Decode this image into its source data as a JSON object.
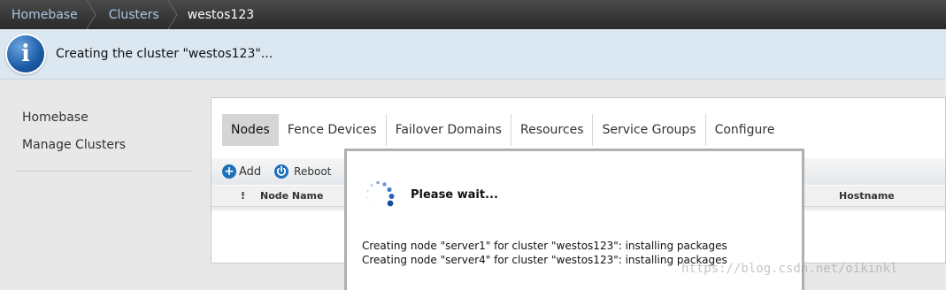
{
  "breadcrumb": {
    "items": [
      {
        "label": "Homebase"
      },
      {
        "label": "Clusters"
      }
    ],
    "current": "westos123"
  },
  "info_banner": {
    "icon": "info-icon",
    "glyph": "i",
    "message": "Creating the cluster \"westos123\"..."
  },
  "sidebar": {
    "items": [
      {
        "label": "Homebase"
      },
      {
        "label": "Manage Clusters"
      }
    ]
  },
  "tabs": [
    {
      "label": "Nodes",
      "active": true
    },
    {
      "label": "Fence Devices"
    },
    {
      "label": "Failover Domains"
    },
    {
      "label": "Resources"
    },
    {
      "label": "Service Groups"
    },
    {
      "label": "Configure"
    }
  ],
  "toolbar": {
    "add_glyph": "+",
    "add_label": "Add",
    "reboot_label": "Reboot"
  },
  "table": {
    "columns": {
      "status": "!",
      "node_name": "Node Name",
      "hostname": "Hostname"
    }
  },
  "modal": {
    "title": "Please wait...",
    "messages": [
      "Creating node \"server1\" for cluster \"westos123\": installing packages",
      "Creating node \"server4\" for cluster \"westos123\": installing packages"
    ]
  },
  "watermark": "https://blog.csdn.net/oikinkl",
  "colors": {
    "accent_blue": "#1c6fb8",
    "crumb_link": "#a9c6e3",
    "banner_bg": "#dbe8f2"
  }
}
